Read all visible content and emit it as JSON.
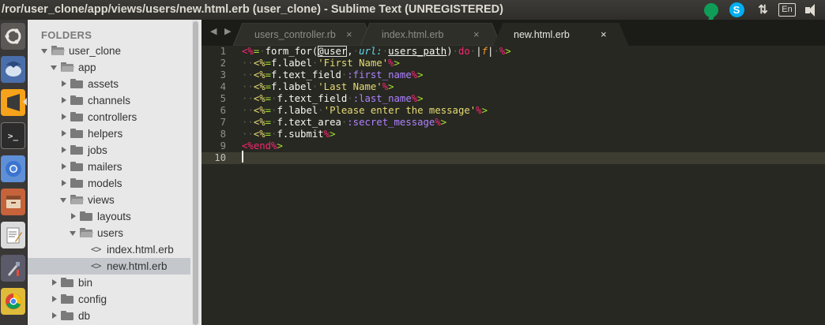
{
  "window": {
    "title": "/ror/user_clone/app/views/users/new.html.erb (user_clone) - Sublime Text (UNREGISTERED)"
  },
  "tray": {
    "hangouts_icon": "hangouts-icon",
    "skype_label": "S",
    "network_label": "⇅",
    "keyboard_label": "En",
    "sound_icon": "sound-icon"
  },
  "launcher": {
    "items": [
      "ubuntu-dash",
      "thunderbird",
      "sublime-text",
      "terminal",
      "chromium",
      "files",
      "text-editor",
      "system-settings",
      "chrome"
    ]
  },
  "sidebar": {
    "header": "FOLDERS",
    "tree": [
      {
        "label": "user_clone",
        "type": "folder",
        "open": true,
        "depth": 0
      },
      {
        "label": "app",
        "type": "folder",
        "open": true,
        "depth": 1
      },
      {
        "label": "assets",
        "type": "folder",
        "open": false,
        "depth": 2
      },
      {
        "label": "channels",
        "type": "folder",
        "open": false,
        "depth": 2
      },
      {
        "label": "controllers",
        "type": "folder",
        "open": false,
        "depth": 2
      },
      {
        "label": "helpers",
        "type": "folder",
        "open": false,
        "depth": 2
      },
      {
        "label": "jobs",
        "type": "folder",
        "open": false,
        "depth": 2
      },
      {
        "label": "mailers",
        "type": "folder",
        "open": false,
        "depth": 2
      },
      {
        "label": "models",
        "type": "folder",
        "open": false,
        "depth": 2
      },
      {
        "label": "views",
        "type": "folder",
        "open": true,
        "depth": 2
      },
      {
        "label": "layouts",
        "type": "folder",
        "open": false,
        "depth": 3
      },
      {
        "label": "users",
        "type": "folder",
        "open": true,
        "depth": 3
      },
      {
        "label": "index.html.erb",
        "type": "file",
        "depth": 4
      },
      {
        "label": "new.html.erb",
        "type": "file",
        "depth": 4,
        "selected": true
      },
      {
        "label": "bin",
        "type": "folder",
        "open": false,
        "depth": 1
      },
      {
        "label": "config",
        "type": "folder",
        "open": false,
        "depth": 1
      },
      {
        "label": "db",
        "type": "folder",
        "open": false,
        "depth": 1
      }
    ]
  },
  "tabs": [
    {
      "label": "users_controller.rb",
      "active": false,
      "close": "×"
    },
    {
      "label": "index.html.erb",
      "active": false,
      "close": "×"
    },
    {
      "label": "new.html.erb",
      "active": true,
      "close": "×"
    }
  ],
  "nav_arrows": "◀ ▶",
  "editor": {
    "line_numbers": [
      "1",
      "2",
      "3",
      "4",
      "5",
      "6",
      "7",
      "8",
      "9",
      "10"
    ],
    "current_line": 10,
    "lines": [
      [
        [
          "p",
          "<%"
        ],
        [
          "pg",
          "="
        ],
        [
          "d",
          "·"
        ],
        [
          "",
          "form_for("
        ],
        [
          "box",
          "@user"
        ],
        [
          "",
          ","
        ],
        [
          "d",
          "·"
        ],
        [
          "a",
          "url:"
        ],
        [
          "d",
          "·"
        ],
        [
          "ul",
          "users_path"
        ],
        [
          "",
          ")"
        ],
        [
          "d",
          "·"
        ],
        [
          "k",
          "do"
        ],
        [
          "d",
          "·"
        ],
        [
          "",
          "|"
        ],
        [
          "i",
          "f"
        ],
        [
          "",
          "|"
        ],
        [
          "d",
          "·"
        ],
        [
          "p",
          "%"
        ],
        [
          "pg",
          ">"
        ]
      ],
      [
        [
          "d",
          "··"
        ],
        [
          "s",
          "<%"
        ],
        [
          "pg",
          "="
        ],
        [
          "",
          "f.label"
        ],
        [
          "d",
          "·"
        ],
        [
          "s",
          "'First Name'"
        ],
        [
          "p",
          "%"
        ],
        [
          "pg",
          ">"
        ]
      ],
      [
        [
          "d",
          "··"
        ],
        [
          "s",
          "<%"
        ],
        [
          "pg",
          "="
        ],
        [
          "",
          "f.text_field"
        ],
        [
          "d",
          "·"
        ],
        [
          "c",
          ":first_name"
        ],
        [
          "p",
          "%"
        ],
        [
          "pg",
          ">"
        ]
      ],
      [
        [
          "d",
          "··"
        ],
        [
          "s",
          "<%"
        ],
        [
          "pg",
          "="
        ],
        [
          "",
          "f.label"
        ],
        [
          "d",
          "·"
        ],
        [
          "s",
          "'Last Name'"
        ],
        [
          "p",
          "%"
        ],
        [
          "pg",
          ">"
        ]
      ],
      [
        [
          "d",
          "··"
        ],
        [
          "s",
          "<%"
        ],
        [
          "pg",
          "="
        ],
        [
          "d",
          "·"
        ],
        [
          "",
          "f.text_field"
        ],
        [
          "d",
          "·"
        ],
        [
          "c",
          ":last_name"
        ],
        [
          "p",
          "%"
        ],
        [
          "pg",
          ">"
        ]
      ],
      [
        [
          "d",
          "··"
        ],
        [
          "s",
          "<%"
        ],
        [
          "pg",
          "="
        ],
        [
          "d",
          "·"
        ],
        [
          "",
          "f.label"
        ],
        [
          "d",
          "·"
        ],
        [
          "s",
          "'Please enter the message'"
        ],
        [
          "p",
          "%"
        ],
        [
          "pg",
          ">"
        ]
      ],
      [
        [
          "d",
          "··"
        ],
        [
          "s",
          "<%"
        ],
        [
          "pg",
          "="
        ],
        [
          "d",
          "·"
        ],
        [
          "",
          "f.text_area"
        ],
        [
          "d",
          "·"
        ],
        [
          "c",
          ":secret_message"
        ],
        [
          "p",
          "%"
        ],
        [
          "pg",
          ">"
        ]
      ],
      [
        [
          "d",
          "··"
        ],
        [
          "s",
          "<%"
        ],
        [
          "pg",
          "="
        ],
        [
          "d",
          "·"
        ],
        [
          "",
          "f.submit"
        ],
        [
          "p",
          "%"
        ],
        [
          "pg",
          ">"
        ]
      ],
      [
        [
          "p",
          "<%"
        ],
        [
          "k",
          "end"
        ],
        [
          "p",
          "%"
        ],
        [
          "pg",
          ">"
        ]
      ],
      []
    ]
  },
  "colors": {
    "editor_bg": "#272822",
    "sidebar_bg": "#e8e8e8",
    "title_bg": "#3c3b37"
  }
}
